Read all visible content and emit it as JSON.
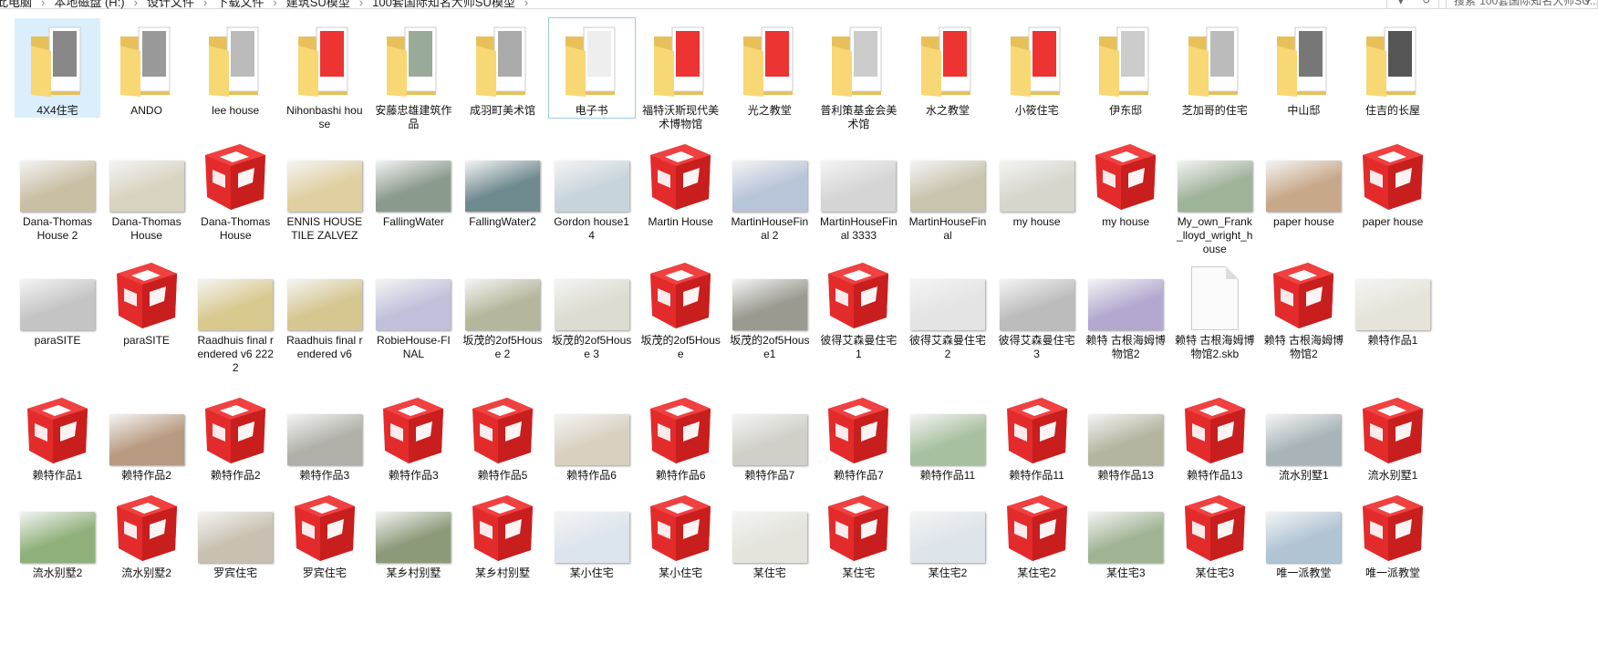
{
  "address": {
    "breadcrumb": [
      "此电脑",
      "本地磁盘 (H:)",
      "设计文件",
      "下载文件",
      "建筑SU模型",
      "100套国际知名大师SU模型"
    ],
    "refresh_icon": "refresh-icon",
    "dropdown_icon": "chevron-down-icon"
  },
  "search": {
    "placeholder": "搜索\"100套国际知名大师SU...",
    "icon": "search-icon"
  },
  "colors": {
    "sketchup_red": "#e32b2b",
    "folder": "#f8d775",
    "selection": "#dbeefb"
  },
  "rows": [
    [
      {
        "name": "4X4住宅",
        "type": "folder"
      },
      {
        "name": "ANDO",
        "type": "folder"
      },
      {
        "name": "lee house",
        "type": "folder"
      },
      {
        "name": "Nihonbashi house",
        "type": "folder"
      },
      {
        "name": "安藤忠雄建筑作品",
        "type": "folder"
      },
      {
        "name": "成羽町美术馆",
        "type": "folder"
      },
      {
        "name": "电子书",
        "type": "folder"
      },
      {
        "name": "福特沃斯现代美术博物馆",
        "type": "folder"
      },
      {
        "name": "光之教堂",
        "type": "folder"
      },
      {
        "name": "普利策基金会美术馆",
        "type": "folder"
      },
      {
        "name": "水之教堂",
        "type": "folder"
      },
      {
        "name": "小筱住宅",
        "type": "folder"
      },
      {
        "name": "伊东邸",
        "type": "folder"
      },
      {
        "name": "芝加哥的住宅",
        "type": "folder"
      },
      {
        "name": "中山邸",
        "type": "folder"
      },
      {
        "name": "住吉的长屋",
        "type": "folder"
      }
    ],
    [
      {
        "name": "Dana-Thomas House 2",
        "type": "thumb",
        "color": "#c9bfa4"
      },
      {
        "name": "Dana-Thomas House",
        "type": "thumb",
        "color": "#d8d2c0"
      },
      {
        "name": "Dana-Thomas House",
        "type": "su"
      },
      {
        "name": "ENNIS HOUSE TILE ZALVEZ",
        "type": "thumb",
        "color": "#e0cfa0"
      },
      {
        "name": "FallingWater",
        "type": "thumb",
        "color": "#8a9a8c"
      },
      {
        "name": "FallingWater2",
        "type": "thumb",
        "color": "#6f8a8f"
      },
      {
        "name": "Gordon house14",
        "type": "thumb",
        "color": "#c8d4dc"
      },
      {
        "name": "Martin House",
        "type": "su"
      },
      {
        "name": "MartinHouseFinal  2",
        "type": "thumb",
        "color": "#b8c4d8"
      },
      {
        "name": "MartinHouseFinal  3333",
        "type": "thumb",
        "color": "#d5d5d5"
      },
      {
        "name": "MartinHouseFinal",
        "type": "thumb",
        "color": "#c9c4ae"
      },
      {
        "name": "my house",
        "type": "thumb",
        "color": "#d6d6cc"
      },
      {
        "name": "my house",
        "type": "su"
      },
      {
        "name": "My_own_Frank_lloyd_wright_house",
        "type": "thumb",
        "color": "#9fb29a"
      },
      {
        "name": "paper house",
        "type": "thumb",
        "color": "#c8a88a"
      },
      {
        "name": "paper house",
        "type": "su"
      }
    ],
    [
      {
        "name": "paraSITE",
        "type": "thumb",
        "color": "#c4c4c4"
      },
      {
        "name": "paraSITE",
        "type": "su"
      },
      {
        "name": "Raadhuis final rendered v6 2222",
        "type": "thumb",
        "color": "#d9c98f"
      },
      {
        "name": "Raadhuis final rendered v6",
        "type": "thumb",
        "color": "#d6c690"
      },
      {
        "name": "RobieHouse-FINAL",
        "type": "thumb",
        "color": "#c0c0dc"
      },
      {
        "name": "坂茂的2of5House 2",
        "type": "thumb",
        "color": "#b6b69c"
      },
      {
        "name": "坂茂的2of5House 3",
        "type": "thumb",
        "color": "#dcdcd0"
      },
      {
        "name": "坂茂的2of5House",
        "type": "su"
      },
      {
        "name": "坂茂的2of5House1",
        "type": "thumb",
        "color": "#9a9a90"
      },
      {
        "name": "彼得艾森曼住宅1",
        "type": "su"
      },
      {
        "name": "彼得艾森曼住宅2",
        "type": "thumb",
        "color": "#e4e4e4"
      },
      {
        "name": "彼得艾森曼住宅3",
        "type": "thumb",
        "color": "#bcbcbc"
      },
      {
        "name": "赖特 古根海姆博物馆2",
        "type": "thumb",
        "color": "#b4a8d0"
      },
      {
        "name": "赖特 古根海姆博物馆2.skb",
        "type": "file"
      },
      {
        "name": "赖特 古根海姆博物馆2",
        "type": "su"
      },
      {
        "name": "赖特作品1",
        "type": "thumb",
        "color": "#e6e4d8"
      }
    ],
    [
      {
        "name": "赖特作品1",
        "type": "su"
      },
      {
        "name": "赖特作品2",
        "type": "thumb",
        "color": "#b89a80"
      },
      {
        "name": "赖特作品2",
        "type": "su"
      },
      {
        "name": "赖特作品3",
        "type": "thumb",
        "color": "#b0b0a8"
      },
      {
        "name": "赖特作品3",
        "type": "su"
      },
      {
        "name": "赖特作品5",
        "type": "su"
      },
      {
        "name": "赖特作品6",
        "type": "thumb",
        "color": "#d8d0c0"
      },
      {
        "name": "赖特作品6",
        "type": "su"
      },
      {
        "name": "赖特作品7",
        "type": "thumb",
        "color": "#d0d0c8"
      },
      {
        "name": "赖特作品7",
        "type": "su"
      },
      {
        "name": "赖特作品11",
        "type": "thumb",
        "color": "#a8c0a0"
      },
      {
        "name": "赖特作品11",
        "type": "su"
      },
      {
        "name": "赖特作品13",
        "type": "thumb",
        "color": "#b4b4a0"
      },
      {
        "name": "赖特作品13",
        "type": "su"
      },
      {
        "name": "流水别墅1",
        "type": "thumb",
        "color": "#a8b4b8"
      },
      {
        "name": "流水别墅1",
        "type": "su"
      }
    ],
    [
      {
        "name": "流水别墅2",
        "type": "thumb",
        "color": "#8fb07a"
      },
      {
        "name": "流水别墅2",
        "type": "su"
      },
      {
        "name": "罗宾住宅",
        "type": "thumb",
        "color": "#c8c0b0"
      },
      {
        "name": "罗宾住宅",
        "type": "su"
      },
      {
        "name": "某乡村别墅",
        "type": "thumb",
        "color": "#8c9a7a"
      },
      {
        "name": "某乡村别墅",
        "type": "su"
      },
      {
        "name": "某小住宅",
        "type": "thumb",
        "color": "#dce4ec"
      },
      {
        "name": "某小住宅",
        "type": "su"
      },
      {
        "name": "某住宅",
        "type": "thumb",
        "color": "#e4e4dc"
      },
      {
        "name": "某住宅",
        "type": "su"
      },
      {
        "name": "某住宅2",
        "type": "thumb",
        "color": "#dde4ea"
      },
      {
        "name": "某住宅2",
        "type": "su"
      },
      {
        "name": "某住宅3",
        "type": "thumb",
        "color": "#a0b494"
      },
      {
        "name": "某住宅3",
        "type": "su"
      },
      {
        "name": "唯一派教堂",
        "type": "thumb",
        "color": "#b0c4d4"
      },
      {
        "name": "唯一派教堂",
        "type": "su"
      }
    ]
  ]
}
